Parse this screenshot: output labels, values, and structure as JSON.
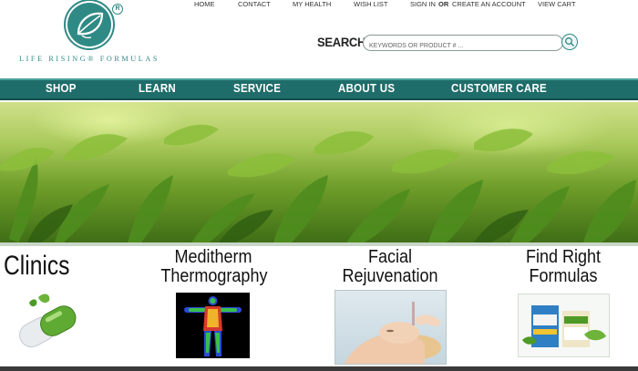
{
  "brand": {
    "name": "LIFE RISING® FORMULAS",
    "registered": "R",
    "color": "#2f8a85"
  },
  "toplinks": [
    "HOME",
    "CONTACT",
    "MY HEALTH",
    "WISH LIST",
    "SIGN IN",
    "OR",
    "CREATE AN ACCOUNT",
    "VIEW CART"
  ],
  "search": {
    "label": "SEARCH",
    "placeholder": "KEYWORDS OR PRODUCT # ..."
  },
  "nav": {
    "items": [
      "SHOP",
      "LEARN",
      "SERVICE",
      "ABOUT US",
      "CUSTOMER CARE"
    ],
    "background": "#1f6d6a"
  },
  "features": {
    "clinics": "Clinics",
    "meditherm_line1": "Meditherm",
    "meditherm_line2": "Thermography",
    "facial_line1": "Facial",
    "facial_line2": "Rejuvenation",
    "formulas_line1": "Find Right",
    "formulas_line2": "Formulas"
  }
}
